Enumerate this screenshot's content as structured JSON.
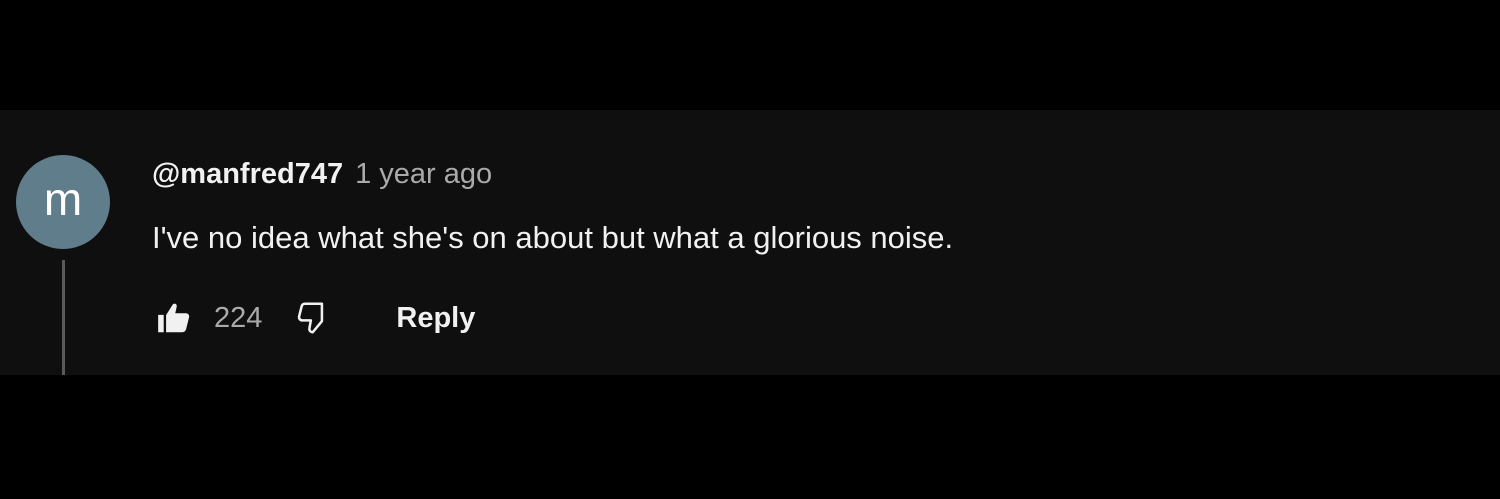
{
  "comment": {
    "avatar_letter": "m",
    "author": "@manfred747",
    "timestamp": "1 year ago",
    "text": "I've no idea what she's on about but what a glorious noise.",
    "like_count": "224",
    "reply_label": "Reply",
    "like_icon": "thumbs-up-filled-icon",
    "dislike_icon": "thumbs-down-outline-icon",
    "colors": {
      "avatar_bg": "#607d8b",
      "panel_bg": "#0f0f0f",
      "page_bg": "#000000",
      "primary_text": "#f1f1f1",
      "secondary_text": "#aaaaaa"
    }
  }
}
